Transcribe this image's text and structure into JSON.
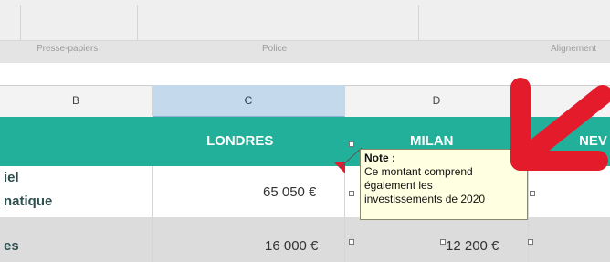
{
  "ribbon": {
    "groups": [
      "Presse-papiers",
      "Police",
      "Alignement"
    ]
  },
  "columns": {
    "B": "B",
    "C": "C",
    "D": "D"
  },
  "header_row": {
    "col_c": "LONDRES",
    "col_d": "MILAN",
    "col_e": "NEV"
  },
  "rows": [
    {
      "label_line1": "iel",
      "label_line2": "natique",
      "col_c": "65 050 €"
    },
    {
      "label_line1": "es",
      "col_c": "16 000 €",
      "col_d": "12 200 €"
    }
  ],
  "note": {
    "title": "Note :",
    "lines": [
      "Ce montant comprend",
      "également les",
      "investissements de 2020"
    ]
  },
  "colors": {
    "teal": "#23b09a",
    "selected_column": "#c5d9ec",
    "note_background": "#ffffe1",
    "arrow_red": "#e31b2b"
  },
  "icons": {
    "arrow": "red-arrow-icon",
    "comment_indicator": "comment-indicator-icon"
  }
}
